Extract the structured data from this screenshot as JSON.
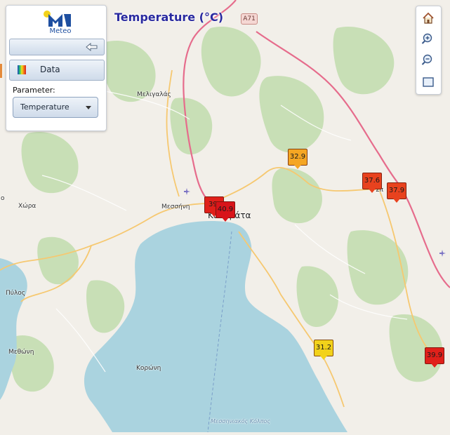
{
  "map": {
    "title": "Temperature (°C)",
    "road_shield": "A71",
    "places": [
      {
        "name": "Μελιγαλάς",
        "style": "town"
      },
      {
        "name": "Μεσσήνη",
        "style": "town"
      },
      {
        "name": "Καλαμάτα",
        "style": "city"
      },
      {
        "name": "Χώρα",
        "style": "town"
      },
      {
        "name": "Πύλος",
        "style": "town"
      },
      {
        "name": "Μεθώνη",
        "style": "town"
      },
      {
        "name": "Κορώνη",
        "style": "town"
      },
      {
        "name": "Σπ",
        "style": "town"
      },
      {
        "name": "Μεσσηνιακός Κόλπος",
        "style": "sea"
      },
      {
        "name": "ο",
        "style": "town"
      }
    ]
  },
  "panel": {
    "logo_text": "Meteo",
    "data_button_label": "Data",
    "parameter_label": "Parameter:",
    "parameter_value": "Temperature"
  },
  "stations": [
    {
      "value": "32.9",
      "color": "#f5a623"
    },
    {
      "value": "37.6",
      "color": "#e8421e"
    },
    {
      "value": "37.9",
      "color": "#e8421e"
    },
    {
      "value": "39.",
      "color": "#e0201a"
    },
    {
      "value": "40.9",
      "color": "#d8141a"
    },
    {
      "value": "31.2",
      "color": "#f2d21a"
    },
    {
      "value": "39.9",
      "color": "#e0201a"
    }
  ],
  "controls": {
    "icons": [
      "home-icon",
      "zoom-in-icon",
      "zoom-out-icon",
      "zoom-extent-icon"
    ]
  },
  "colors": {
    "sea": "#aad3df",
    "land": "#f2efe9",
    "forest": "#c8dfb6",
    "highway": "#e66c8c",
    "primary_road": "#f6c870",
    "title": "#2a2aa0",
    "accent": "#1e4fa0"
  }
}
